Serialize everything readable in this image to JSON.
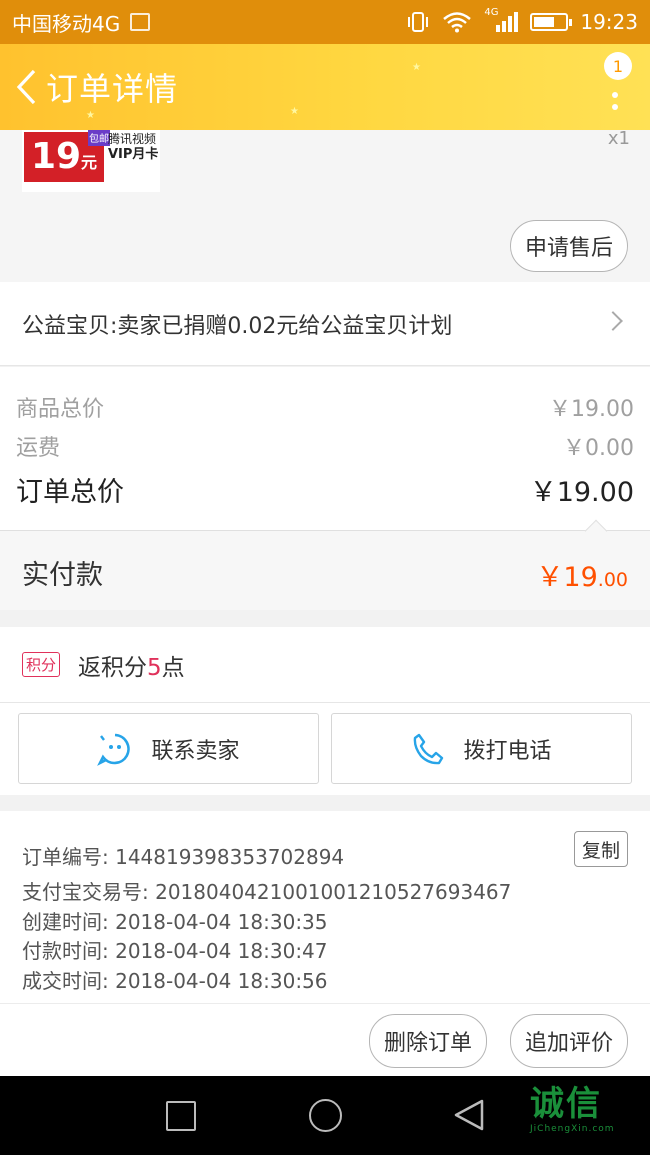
{
  "status_bar": {
    "carrier": "中国移动4G",
    "time": "19:23",
    "network": "4G"
  },
  "header": {
    "title": "订单详情",
    "badge_count": "1"
  },
  "product": {
    "thumb_price": "19",
    "thumb_unit": "元",
    "thumb_hot": "包邮",
    "thumb_brand_line1": "腾讯视频",
    "thumb_brand_line2": "VIP月卡",
    "quantity": "x1",
    "aftersale_label": "申请售后"
  },
  "charity": {
    "text": "公益宝贝:卖家已捐赠0.02元给公益宝贝计划"
  },
  "summary": {
    "goods_total_label": "商品总价",
    "goods_total_value": "￥19.00",
    "shipping_label": "运费",
    "shipping_value": "￥0.00",
    "order_total_label": "订单总价",
    "order_total_value": "￥19.00"
  },
  "paid": {
    "label": "实付款",
    "currency": "￥",
    "integer": "19",
    "cents": ".00"
  },
  "points": {
    "tag": "积分",
    "prefix": "返积分",
    "num": "5",
    "suffix": "点"
  },
  "contact": {
    "seller_label": "联系卖家",
    "phone_label": "拨打电话"
  },
  "order_info": {
    "order_no": "订单编号: 1448193983537028​94",
    "alipay_no": "支付宝交易号: 2018040421001001210527693467",
    "created": "创建时间: 2018-04-04 18:30:35",
    "paid": "付款时间: 2018-04-04 18:30:47",
    "completed": "成交时间: 2018-04-04 18:30:56",
    "copy_label": "复制"
  },
  "actions": {
    "delete_label": "删除订单",
    "review_label": "追加评价"
  },
  "watermark": {
    "main": "诚信",
    "sub": "JiChengXin.com"
  },
  "colors": {
    "header": "#ffc22e",
    "status_bar": "#e08e0b",
    "price_accent": "#ff5000",
    "points_accent": "#e0315b"
  }
}
